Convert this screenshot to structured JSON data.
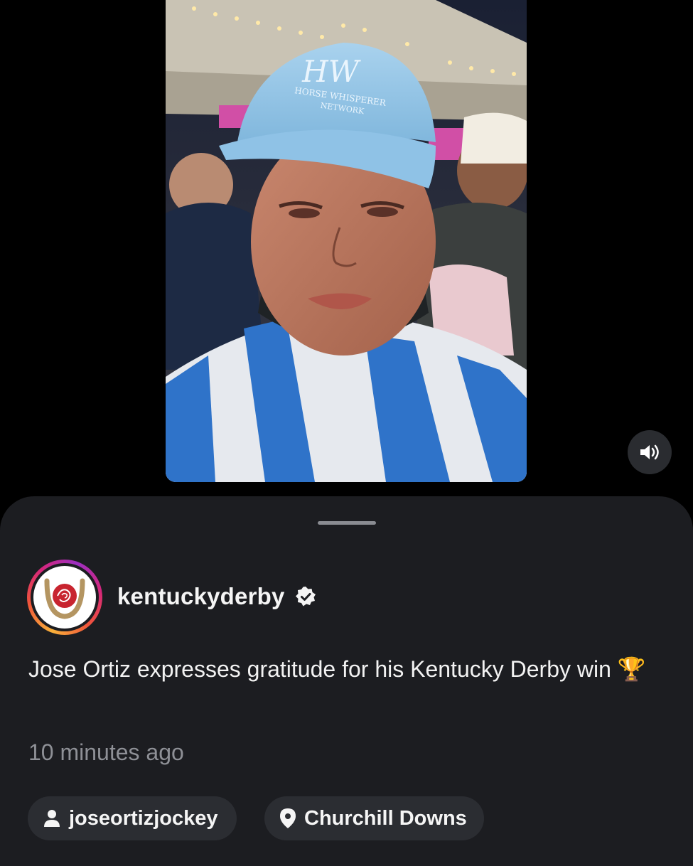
{
  "post": {
    "username": "kentuckyderby",
    "verified": true,
    "caption": "Jose Ortiz expresses gratitude for his Kentucky Derby win 🏆",
    "timestamp": "10 minutes ago",
    "tags": {
      "user": "joseortizjockey",
      "location": "Churchill Downs"
    }
  },
  "video": {
    "cap_logo": "HW",
    "cap_text_line1": "HORSE WHISPERER",
    "cap_text_line2": "NETWORK"
  },
  "icons": {
    "mute": "speaker-icon",
    "verified": "verified-badge-icon",
    "user": "person-icon",
    "location": "location-pin-icon",
    "avatar": "kentucky-derby-rose-logo"
  },
  "colors": {
    "sheet": "#1c1d21",
    "chip": "#2b2d32",
    "muted_text": "#8e9096",
    "accent_ring": "#d6267b"
  }
}
